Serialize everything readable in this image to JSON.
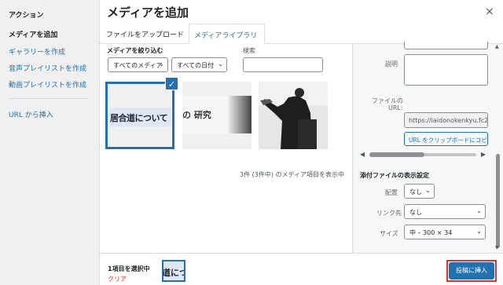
{
  "left_menu": {
    "title": "アクション",
    "items": [
      {
        "label": "メディアを追加"
      },
      {
        "label": "ギャラリーを作成"
      },
      {
        "label": "音声プレイリストを作成"
      },
      {
        "label": "動画プレイリストを作成"
      },
      {
        "label": "URL から挿入"
      }
    ]
  },
  "header": {
    "title": "メディアを追加",
    "close_glyph": "×",
    "tabs": [
      {
        "label": "ファイルをアップロード"
      },
      {
        "label": "メディアライブラリ"
      }
    ]
  },
  "toolbar": {
    "filter_label": "メディアを絞り込む",
    "type_select": "すべてのメディア",
    "date_select": "すべての日付",
    "search_label": "検索",
    "search_value": ""
  },
  "thumbnails": [
    {
      "text": "居合道について",
      "selected": true
    },
    {
      "text": "の 研究"
    },
    {
      "text": ""
    }
  ],
  "count_text": "3件 (3件中) のメディア項目を表示中",
  "sidebar": {
    "description_label": "説明",
    "file_url_label_1": "ファイルの",
    "file_url_label_2": "URL:",
    "file_url_value": "https://iaidonokenkyu.fc2",
    "copy_button": "URL をクリップボードにコピー",
    "settings_heading": "添付ファイルの表示設定",
    "align_label": "配置",
    "align_value": "なし",
    "link_label": "リンク先",
    "link_value": "なし",
    "size_label": "サイズ",
    "size_value": "中 – 300 × 34"
  },
  "bottom": {
    "selected_count": "1項目を選択中",
    "clear_label": "クリア",
    "mini_thumb_text": "道につ",
    "insert_button": "投稿に挿入"
  },
  "colors": {
    "accent": "#2271b1",
    "danger": "#d63638"
  }
}
